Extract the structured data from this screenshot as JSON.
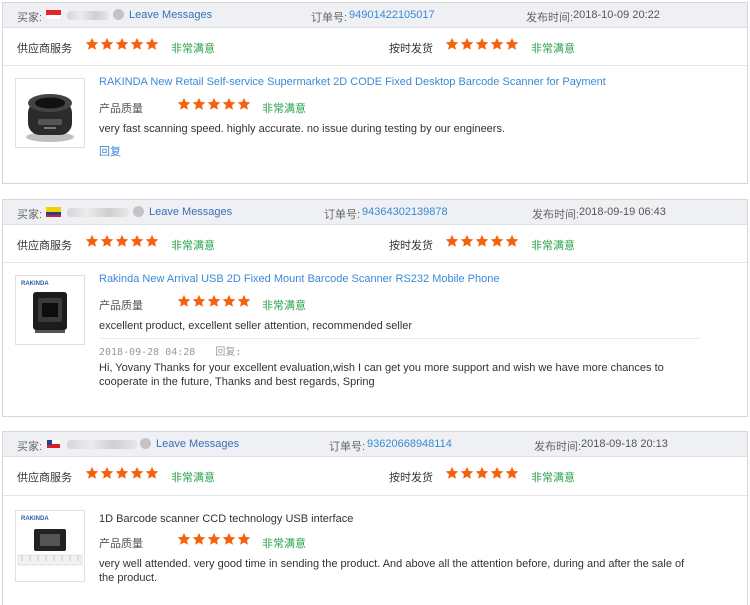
{
  "labels": {
    "buyer": "买家:",
    "leave_messages": "Leave Messages",
    "order_no": "订单号:",
    "published": "发布时间:",
    "supplier_service": "供应商服务",
    "on_time_delivery": "按时发货",
    "very_satisfied": "非常满意",
    "product_quality": "产品质量",
    "reply_action": "回复",
    "reply_prefix": "回复:"
  },
  "colors": {
    "star": "#f5620f",
    "satisfied": "#2aa14b",
    "link": "#3a8ad6"
  },
  "reviews": [
    {
      "country_flag": "singapore-flag",
      "order_number": "94901422105017",
      "publish_time": "2018-10-09 20:22",
      "supplier_service_stars": 5,
      "on_time_delivery_stars": 5,
      "product_title": "RAKINDA New Retail Self-service Supermarket 2D CODE Fixed Desktop Barcode Scanner for Payment",
      "product_quality_stars": 5,
      "review_text": "very fast scanning speed. highly accurate. no issue during testing by our engineers."
    },
    {
      "country_flag": "colombia-flag",
      "order_number": "94364302139878",
      "publish_time": "2018-09-19 06:43",
      "supplier_service_stars": 5,
      "on_time_delivery_stars": 5,
      "product_title": "Rakinda New Arrival USB 2D Fixed Mount Barcode Scanner RS232 Mobile Phone",
      "product_quality_stars": 5,
      "review_text": "excellent product, excellent seller attention, recommended seller",
      "reply_time": "2018-09-28 04:28",
      "reply_text": "Hi, Yovany Thanks for your excellent evaluation,wish I can get you more support and wish we have more chances to cooperate in the future, Thanks and best regards, Spring",
      "thumb_brand": "RAKINDA"
    },
    {
      "country_flag": "chile-flag",
      "order_number": "93620668948114",
      "publish_time": "2018-09-18 20:13",
      "supplier_service_stars": 5,
      "on_time_delivery_stars": 5,
      "product_title": "1D Barcode scanner CCD technology USB interface",
      "product_quality_stars": 5,
      "review_text": "very well attended. very good time in sending the product. And above all the attention before, during and after the sale of the product.",
      "thumb_brand": "RAKINDA"
    }
  ]
}
